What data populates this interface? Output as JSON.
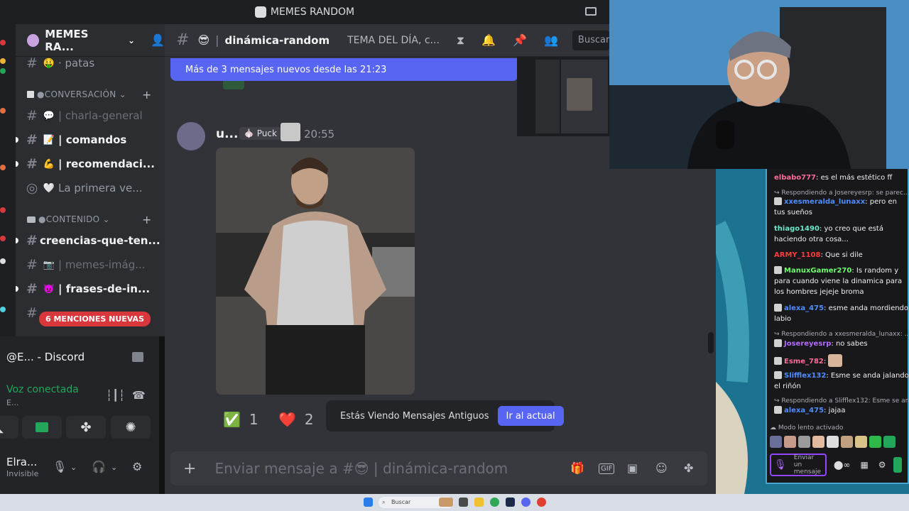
{
  "window": {
    "title": "MEMES RANDOM"
  },
  "guild": {
    "name": "MEMES RA..."
  },
  "channels": [
    {
      "emoji": "🤑",
      "name": "· patas",
      "style": "normal"
    },
    {
      "category": "CONVERSACIÓN"
    },
    {
      "emoji": "💬",
      "name": "| charla-general",
      "style": "dim"
    },
    {
      "emoji": "📝",
      "name": "| comandos",
      "style": "bold"
    },
    {
      "emoji": "💪",
      "name": "| recomendaci...",
      "style": "bold"
    },
    {
      "emoji": "🤍",
      "name": "La primera ve...",
      "style": "normal"
    },
    {
      "category": "CONTENIDO"
    },
    {
      "emoji": "",
      "name": "creencias-que-ten...",
      "style": "bold"
    },
    {
      "emoji": "📷",
      "name": "| memes-imág...",
      "style": "dim"
    },
    {
      "emoji": "👿",
      "name": "| frases-de-in...",
      "style": "bold"
    }
  ],
  "mentions_pill": "6 MENCIONES NUEVAS",
  "call": {
    "title": "@E... - Discord",
    "status": "Voz conectada",
    "sub": "E..."
  },
  "user": {
    "name": "Elra...",
    "status": "Invisible"
  },
  "channel_header": {
    "name": "dinámica-random",
    "emoji": "😎",
    "topic": "TEMA DEL DÍA, c...",
    "search_placeholder": "Buscar MEMES"
  },
  "new_messages_banner": "Más de 3 mensajes nuevos desde las 21:23",
  "message": {
    "author": "u...",
    "badge": "Puck",
    "time": "20:55"
  },
  "reactions": [
    {
      "emoji": "✅",
      "count": "1"
    },
    {
      "emoji": "❤️",
      "count": "2"
    }
  ],
  "old_messages": {
    "text": "Estás Viendo Mensajes Antiguos",
    "button": "Ir al actual"
  },
  "composer": {
    "placeholder": "Enviar mensaje a #😎 | dinámica-random"
  },
  "twitch_chat": [
    {
      "user": "elbabo777",
      "color": "#ff6b9a",
      "text": "es el más estético ff"
    },
    {
      "reply": "Respondiendo a Josereyesrp: se parec..."
    },
    {
      "user": "xxesmeralda_lunaxx",
      "color": "#4f8cff",
      "text": "pero en tus sueños"
    },
    {
      "user": "thiago1490",
      "color": "#6ee6c8",
      "text": "yo creo que está haciendo otra cosa..."
    },
    {
      "user": "ARMY_1108",
      "color": "#ff3b3b",
      "text": "Que si dile"
    },
    {
      "user": "ManuxGamer270",
      "color": "#6bff6b",
      "text": "Is random y para cuando viene la dinamica para los hombres jejeje broma"
    },
    {
      "user": "alexa_475",
      "color": "#4f8cff",
      "text": "esme anda mordiendo labio"
    },
    {
      "reply": "Respondiendo a xxesmeralda_lunaxx: ..."
    },
    {
      "user": "Josereyesrp",
      "color": "#b46bff",
      "text": "no sabes"
    },
    {
      "user": "Esme_782",
      "color": "#ff6b9a",
      "text": ""
    },
    {
      "user": "Slifflex132",
      "color": "#4f8cff",
      "text": "Esme se anda jalando el riñón"
    },
    {
      "reply": "Respondiendo a Slifflex132: Esme se an..."
    },
    {
      "user": "alexa_475",
      "color": "#4f8cff",
      "text": "jajaa"
    }
  ],
  "slow_mode": "Modo lento activado",
  "chat_input_placeholder": "Enviar un mensaje",
  "taskbar": {
    "search": "Buscar"
  }
}
